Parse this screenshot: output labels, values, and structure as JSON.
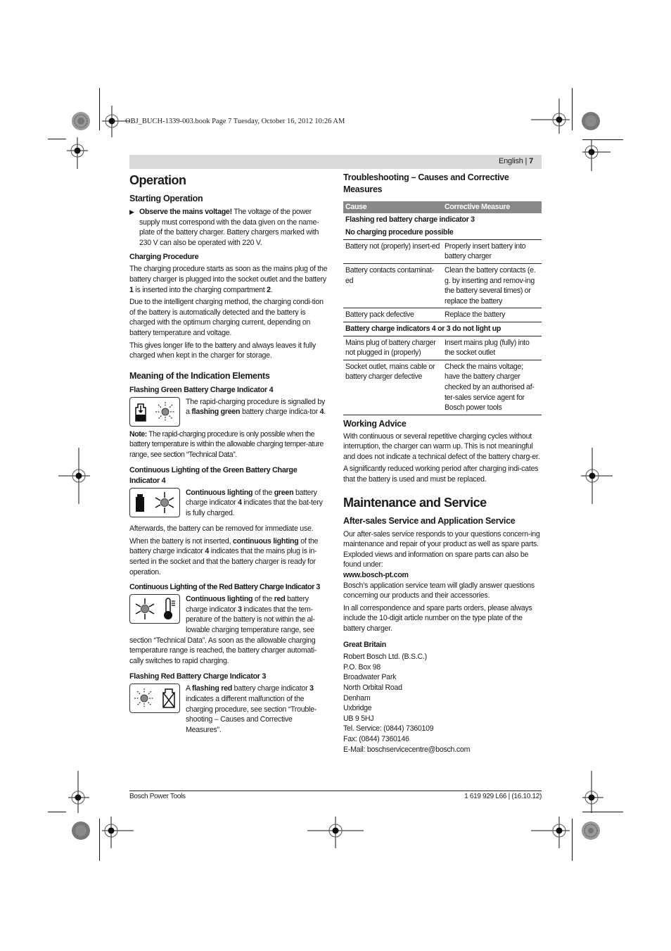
{
  "print_slug": "OBJ_BUCH-1339-003.book  Page 7  Tuesday, October 16, 2012  10:26 AM",
  "header": {
    "language": "English",
    "separator": "|",
    "page_number": "7"
  },
  "left": {
    "title": "Operation",
    "starting_operation": {
      "heading": "Starting Operation",
      "bullet_bold": "Observe the mains voltage!",
      "bullet_text": " The voltage of the power supply must correspond with the data given on the name-plate of the battery charger. Battery chargers marked with 230 V can also be operated with 220 V."
    },
    "charging_procedure": {
      "heading": "Charging Procedure",
      "p1_a": "The charging procedure starts as soon as the mains plug of the battery charger is plugged into the socket outlet and the battery ",
      "p1_b": "1",
      "p1_c": " is inserted into the charging compartment ",
      "p1_d": "2",
      "p1_e": ".",
      "p2": "Due to the intelligent charging method, the charging condi-tion of the battery is automatically detected and the battery is charged with the optimum charging current, depending on battery temperature and voltage.",
      "p3": "This gives longer life to the battery and always leaves it fully charged when kept in the charger for storage."
    },
    "indication": {
      "heading": "Meaning of the Indication Elements",
      "flashing_green": {
        "heading": "Flashing Green Battery Charge Indicator 4",
        "t1": "The rapid-charging procedure is signalled by a ",
        "t2": "flashing green",
        "t3": " battery charge indica-tor ",
        "t4": "4",
        "t5": "."
      },
      "note_label": "Note:",
      "note_text": " The rapid-charging procedure is only possible when the battery temperature is within the allowable charging temper-ature range, see section “Technical Data”.",
      "cont_green": {
        "heading": "Continuous Lighting of the Green Battery Charge Indicator 4",
        "t1": "Continuous lighting",
        "t2": " of the ",
        "t3": "green",
        "t4": " battery charge indicator ",
        "t5": "4",
        "t6": " indicates that the bat-tery is fully charged."
      },
      "afterwards": "Afterwards, the battery can be removed for immediate use.",
      "not_inserted_a": "When the battery is not inserted, ",
      "not_inserted_b": "continuous lighting",
      "not_inserted_c": " of the battery charge indicator ",
      "not_inserted_d": "4",
      "not_inserted_e": " indicates that the mains plug is in-serted in the socket and that the battery charger is ready for operation.",
      "cont_red": {
        "heading": "Continuous Lighting of the Red Battery Charge Indicator 3",
        "t1": "Continuous lighting",
        "t2": " of the ",
        "t3": "red",
        "t4": " battery charge indicator ",
        "t5": "3",
        "t6": " indicates that the tem-perature of the battery is not within the al-lowable charging temperature range, see",
        "t7": "section “Technical Data”. As soon as the allowable charging temperature range is reached, the battery charger automati-cally switches to rapid charging."
      },
      "flashing_red": {
        "heading": "Flashing Red Battery Charge Indicator 3",
        "t1": "A ",
        "t2": "flashing red",
        "t3": " battery charge indicator ",
        "t4": "3",
        "t5": " indicates a different malfunction of the charging procedure, see section “Trouble-shooting – Causes and Corrective Measures”."
      }
    }
  },
  "right": {
    "troubleshooting": {
      "heading": "Troubleshooting – Causes and Corrective Measures",
      "columns": [
        "Cause",
        "Corrective Measure"
      ],
      "groups": [
        {
          "titles": [
            "Flashing red battery charge indicator 3",
            "No charging procedure possible"
          ],
          "rows": [
            [
              "Battery not (properly) insert-ed",
              "Properly insert battery into battery charger"
            ],
            [
              "Battery contacts contaminat-ed",
              "Clean the battery contacts (e. g. by inserting and remov-ing the battery several times) or replace the battery"
            ],
            [
              "Battery pack defective",
              "Replace the battery"
            ]
          ]
        },
        {
          "titles": [
            "Battery charge indicators 4 or 3 do not light up"
          ],
          "rows": [
            [
              "Mains plug of battery charger not plugged in (properly)",
              "Insert mains plug (fully) into the socket outlet"
            ],
            [
              "Socket outlet, mains cable or battery charger defective",
              "Check the mains voltage; have the battery charger checked by an authorised af-ter-sales service agent for Bosch power tools"
            ]
          ]
        }
      ]
    },
    "working_advice": {
      "heading": "Working Advice",
      "p1": "With continuous or several repetitive charging cycles without interruption, the charger can warm up. This is not meaningful and does not indicate a technical defect of the battery charg-er.",
      "p2": "A significantly reduced working period after charging indi-cates that the battery is used and must be replaced."
    },
    "maintenance": {
      "title": "Maintenance and Service",
      "heading": "After-sales Service and Application Service",
      "p1": "Our after-sales service responds to your questions concern-ing maintenance and repair of your product as well as spare parts. Exploded views and information on spare parts can also be found under:",
      "url": "www.bosch-pt.com",
      "p2": "Bosch’s application service team will gladly answer questions concerning our products and their accessories.",
      "p3": "In all correspondence and spare parts orders, please always include the 10-digit article number on the type plate of the battery charger.",
      "country": "Great Britain",
      "address": [
        "Robert Bosch Ltd. (B.S.C.)",
        "P.O. Box 98",
        "Broadwater Park",
        "North Orbital Road",
        "Denham",
        "Uxbridge",
        "UB 9 5HJ",
        "Tel. Service: (0844) 7360109",
        "Fax: (0844) 7360146",
        "E-Mail: boschservicecentre@bosch.com"
      ]
    }
  },
  "footer": {
    "left": "Bosch Power Tools",
    "right": "1 619 929 L66 | (16.10.12)"
  },
  "colors": {
    "header_bar": "#d9d9d9",
    "table_header": "#888888"
  }
}
